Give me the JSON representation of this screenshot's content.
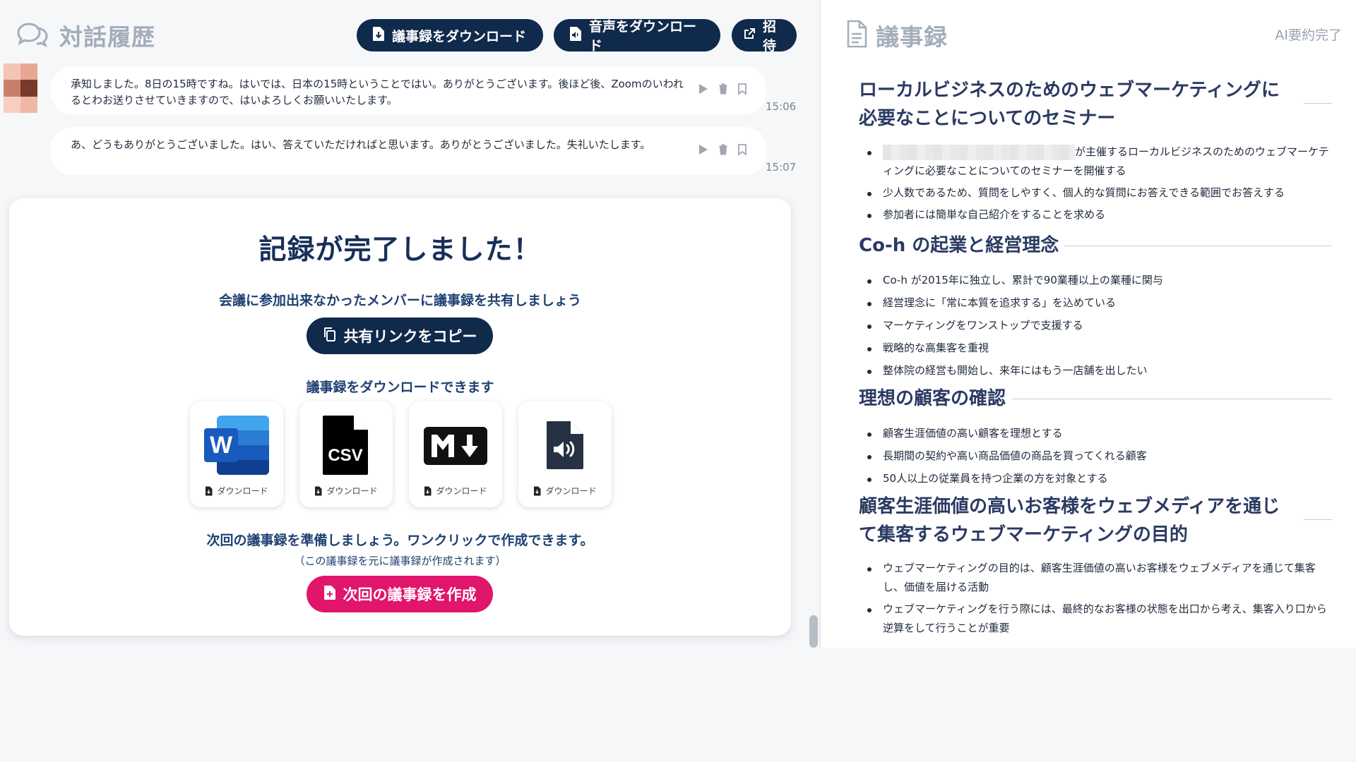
{
  "left_header": {
    "title": "対話履歴",
    "buttons": [
      {
        "label": "議事録をダウンロード",
        "icon": "file-download-icon"
      },
      {
        "label": "音声をダウンロード",
        "icon": "audio-file-icon"
      },
      {
        "label": "招待",
        "icon": "external-link-icon"
      }
    ]
  },
  "messages": [
    {
      "text": "承知しました。8日の15時ですね。はいでは、日本の15時ということではい。ありがとうございます。後ほど後、Zoomのいわれるとわお送りさせていきますので、はいよろしくお願いいたします。",
      "time": "15:06"
    },
    {
      "text": "あ、どうもありがとうございました。はい、答えていただければと思います。ありがとうございました。失礼いたします。",
      "time": "15:07"
    }
  ],
  "complete_card": {
    "title": "記録が完了しました！",
    "share_prompt": "会議に参加出来なかったメンバーに議事録を共有しましょう",
    "copy_link_label": "共有リンクをコピー",
    "download_prompt": "議事録をダウンロードできます",
    "downloads": [
      {
        "format": "Word",
        "icon": "word-icon",
        "label": "ダウンロード"
      },
      {
        "format": "CSV",
        "icon": "csv-icon",
        "label": "ダウンロード"
      },
      {
        "format": "Markdown",
        "icon": "markdown-icon",
        "label": "ダウンロード"
      },
      {
        "format": "Audio",
        "icon": "audio-file-icon",
        "label": "ダウンロード"
      }
    ],
    "next_prompt": "次回の議事録を準備しましょう。ワンクリックで作成できます。",
    "next_note": "（この議事録を元に議事録が作成されます）",
    "next_button_label": "次回の議事録を作成"
  },
  "right_panel": {
    "title": "議事録",
    "status": "AI要約完了",
    "sections": [
      {
        "heading_lines": [
          "ローカルビジネスのためのウェブマーケティングに",
          "必要なことについてのセミナー"
        ],
        "bullets": [
          "が主催するローカルビジネスのためのウェブマーケティングに必要なことについてのセミナーを開催する",
          "少人数であるため、質問をしやすく、個人的な質問にお答えできる範囲でお答えする",
          "参加者には簡単な自己紹介をすることを求める"
        ]
      },
      {
        "heading_lines": [
          "Co-h の起業と経営理念"
        ],
        "bullets": [
          "Co-h が2015年に独立し、累計で90業種以上の業種に関与",
          "経営理念に「常に本質を追求する」を込めている",
          "マーケティングをワンストップで支援する",
          "戦略的な高集客を重視",
          "整体院の経営も開始し、来年にはもう一店舗を出したい"
        ]
      },
      {
        "heading_lines": [
          "理想の顧客の確認"
        ],
        "bullets": [
          "顧客生涯価値の高い顧客を理想とする",
          "長期間の契約や高い商品価値の商品を買ってくれる顧客",
          "50人以上の従業員を持つ企業の方を対象とする"
        ]
      },
      {
        "heading_lines": [
          "顧客生涯価値の高いお客様をウェブメディアを通じ",
          "て集客するウェブマーケティングの目的"
        ],
        "bullets": [
          "ウェブマーケティングの目的は、顧客生涯価値の高いお客様をウェブメディアを通じて集客し、価値を届ける活動",
          "ウェブマーケティングを行う際には、最終的なお客様の状態を出口から考え、集客入り口から逆算をして行うことが重要"
        ]
      }
    ]
  },
  "colors": {
    "navy": "#102a4c",
    "pink": "#e0156b",
    "word_blue": "#185abd",
    "muted": "#a4adbb"
  }
}
